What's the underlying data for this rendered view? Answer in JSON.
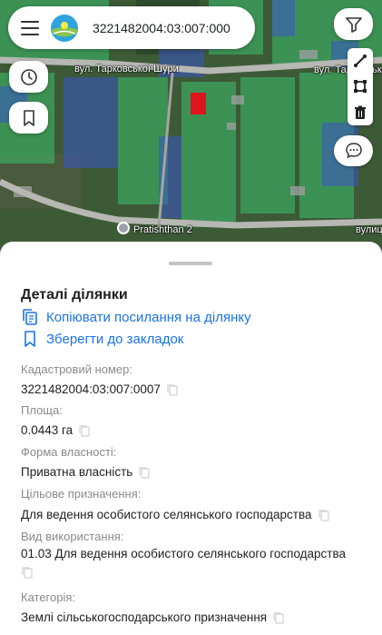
{
  "search": {
    "query": "3221482004:03:007:000"
  },
  "map": {
    "road_label_1": "вул. Тарковської Шури",
    "road_label_2": "вул. Тарковської",
    "road_label_3": "вулиц",
    "poi_label": "Pratishthan 2"
  },
  "details": {
    "title": "Деталі ділянки",
    "copy_link_label": "Копіювати посилання на ділянку",
    "bookmark_label": "Зберегти до закладок",
    "fields": [
      {
        "label": "Кадастровий номер:",
        "value": "3221482004:03:007:0007"
      },
      {
        "label": "Площа:",
        "value": "0.0443 га"
      },
      {
        "label": "Форма власності:",
        "value": "Приватна власність"
      },
      {
        "label": "Цільове призначення:",
        "value": "Для ведення особистого селянського господарства"
      },
      {
        "label": "Вид використання:",
        "value": "01.03 Для ведення особистого селянського господарства"
      },
      {
        "label": "Категорія:",
        "value": "Землі сільськогосподарського призначення"
      }
    ]
  },
  "colors": {
    "accent": "#1a73e8",
    "selected_parcel": "#e0151c",
    "parcel_green": "#3cbf6e",
    "parcel_blue": "#3a56c9"
  },
  "icons": {
    "menu": "menu-icon",
    "filter": "filter-icon",
    "history": "clock-icon",
    "bookmark": "bookmark-icon",
    "ruler": "ruler-icon",
    "area": "area-icon",
    "trash": "trash-icon",
    "chat": "chat-icon",
    "copy": "copy-icon"
  }
}
